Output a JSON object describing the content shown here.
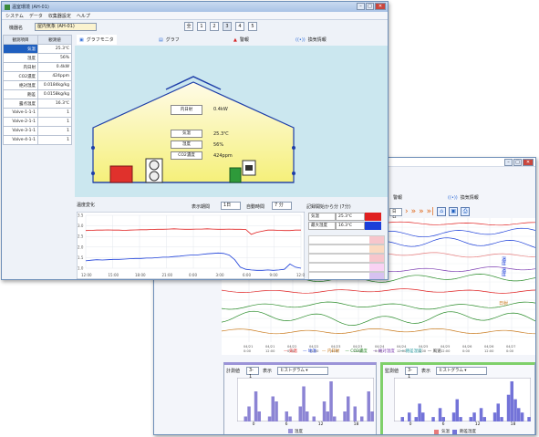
{
  "back_window": {
    "close_label": "✕",
    "tabs": [
      "警報",
      "換気情報"
    ],
    "toolbar_label": "日分",
    "y_label_a": "温度",
    "y_label_b": "温度",
    "y_label_c": "日射",
    "legend": [
      "気温",
      "地温",
      "内日射",
      "CO2濃度",
      "絶対湿度",
      "飽差湿度",
      "風速"
    ],
    "x_ticks": [
      "04/21\n0:00",
      "04/21\n12:00",
      "04/22\n0:00",
      "04/22\n12:00",
      "04/23\n0:00",
      "04/23\n12:00",
      "04/24\n0:00",
      "04/24\n12:00",
      "04/25\n0:00",
      "04/25\n12:00",
      "04/26\n0:00",
      "04/26\n12:00",
      "04/27\n0:00"
    ],
    "bottom_left": {
      "label": "計測値",
      "field_value": "3-1",
      "display_label": "表示",
      "select_value": "ヒストグラム",
      "x_ticks": [
        "0",
        "6",
        "12",
        "18"
      ],
      "legend": "温度"
    },
    "bottom_right": {
      "label": "監測値",
      "field_value": "3-1",
      "display_label": "表示",
      "select_value": "ヒストグラム",
      "x_ticks": [
        "0",
        "6",
        "12",
        "18"
      ],
      "legend": [
        "気温",
        "飽差湿度"
      ]
    },
    "hist_left": [
      0,
      0,
      1,
      3,
      0,
      6,
      2,
      0,
      0,
      1,
      5,
      4,
      0,
      0,
      2,
      1,
      0,
      0,
      3,
      7,
      2,
      0,
      1,
      0,
      0,
      4,
      2,
      8,
      1,
      0,
      0,
      2,
      5,
      0,
      3,
      0,
      1,
      0,
      6,
      2
    ],
    "hist_right": [
      0,
      0,
      1,
      0,
      2,
      0,
      1,
      4,
      2,
      0,
      0,
      1,
      0,
      3,
      1,
      0,
      0,
      2,
      5,
      1,
      0,
      0,
      1,
      2,
      0,
      3,
      1,
      0,
      0,
      2,
      4,
      1,
      0,
      6,
      9,
      5,
      3,
      2,
      0,
      1
    ]
  },
  "front_window": {
    "title": "温室環境 (AH-01)",
    "menu": [
      "システム",
      "データ",
      "収集器設定",
      "ヘルプ"
    ],
    "station_label": "機器名",
    "station_value": "屋内気象 (AH-01)",
    "page_label": "全",
    "pages": [
      "1",
      "2",
      "3",
      "4",
      "5"
    ],
    "tabs": [
      "グラフモニタ",
      "グラフ",
      "警報",
      "換気情報"
    ],
    "sensor_table": {
      "headers": [
        "観測項目",
        "観測値"
      ],
      "rows": [
        [
          "気温",
          "25.3℃"
        ],
        [
          "湿度",
          "56%"
        ],
        [
          "内日射",
          "0.4kW"
        ],
        [
          "CO2濃度",
          "424ppm"
        ],
        [
          "絶対湿度",
          "0.0184kg/kg"
        ],
        [
          "飽差",
          "0.0158kg/kg"
        ],
        [
          "露点温度",
          "16.3℃"
        ],
        [
          "Valve-1-1-1",
          "1"
        ],
        [
          "Valve-2-1-1",
          "1"
        ],
        [
          "Valve-3-1-1",
          "1"
        ],
        [
          "Valve-4-1-1",
          "1"
        ]
      ]
    },
    "house_labels": {
      "inner_radiation": "内日射",
      "inner_radiation_value": "0.4kW",
      "temp": "気温",
      "temp_value": "25.3℃",
      "humidity": "湿度",
      "humidity_value": "56%",
      "co2": "CO2濃度",
      "co2_value": "424ppm"
    },
    "graph_section": {
      "title": "温度変化",
      "interval_label": "表示期間",
      "interval_value": "1日",
      "count_label": "自動時間",
      "count_value": "7 分",
      "status_text": "記録開始から分 (7分)",
      "right_rows": [
        {
          "k": "気温",
          "v": "25.3℃",
          "color": "#e02020"
        },
        {
          "k": "最大湿度",
          "v": "16.3℃",
          "color": "#1c3fd9"
        }
      ],
      "y_ticks": [
        "3.5",
        "3.0",
        "2.5",
        "2.0",
        "1.5",
        "1.0"
      ],
      "x_ticks": [
        "12:00",
        "15:00",
        "18:00",
        "21:00",
        "0:00",
        "3:00",
        "6:00",
        "9:00",
        "12:00"
      ]
    },
    "chart_series": {
      "red": [
        2.78,
        2.79,
        2.8,
        2.8,
        2.81,
        2.8,
        2.8,
        2.79,
        2.8,
        2.81,
        2.82,
        2.82,
        2.83,
        2.84,
        2.84,
        2.85,
        2.86,
        2.85,
        2.84,
        2.84,
        2.85,
        2.85,
        2.86,
        2.85,
        2.84,
        2.84,
        2.85,
        2.84,
        2.84,
        2.83,
        2.6,
        2.7,
        2.75,
        2.8,
        2.8,
        2.79,
        2.78,
        2.78,
        2.8,
        2.8
      ],
      "blue": [
        1.35,
        1.38,
        1.4,
        1.39,
        1.4,
        1.42,
        1.42,
        1.43,
        1.45,
        1.46,
        1.46,
        1.48,
        1.48,
        1.5,
        1.52,
        1.52,
        1.55,
        1.57,
        1.6,
        1.62,
        1.62,
        1.65,
        1.68,
        1.7,
        1.72,
        1.7,
        1.62,
        1.4,
        1.05,
        0.95,
        0.92,
        0.9,
        0.9,
        0.92,
        0.9,
        0.92,
        0.95,
        1.2,
        1.05,
        1.0
      ]
    }
  }
}
